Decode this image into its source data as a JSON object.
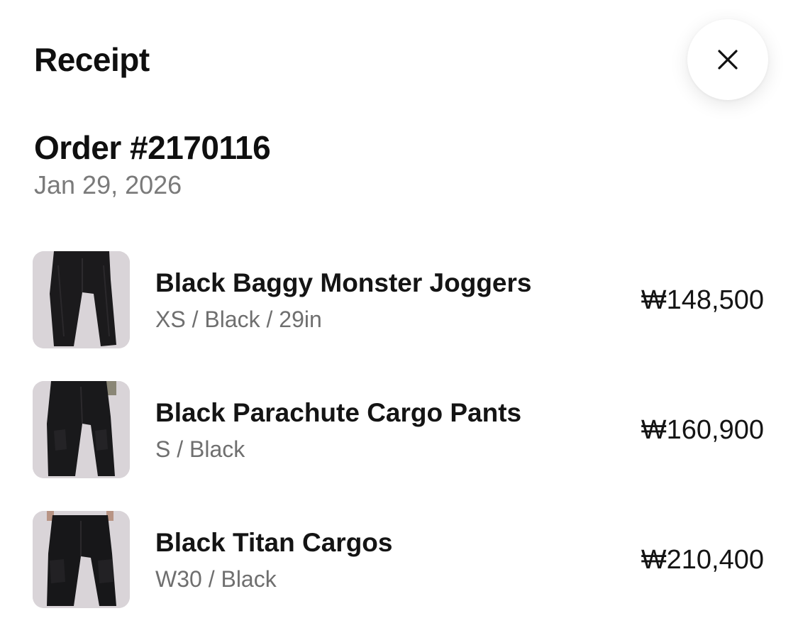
{
  "header": {
    "title": "Receipt",
    "close_icon": "close-icon"
  },
  "order": {
    "number": "Order #2170116",
    "date": "Jan 29, 2026"
  },
  "items": [
    {
      "name": "Black Baggy Monster Joggers",
      "variant": "XS / Black / 29in",
      "price": "₩148,500",
      "image": "product-image-joggers"
    },
    {
      "name": "Black Parachute Cargo Pants",
      "variant": "S / Black",
      "price": "₩160,900",
      "image": "product-image-parachute-cargo"
    },
    {
      "name": "Black Titan Cargos",
      "variant": "W30 / Black",
      "price": "₩210,400",
      "image": "product-image-titan-cargos"
    }
  ],
  "colors": {
    "text_primary": "#141414",
    "text_secondary": "#6f6f6f",
    "thumb_background": "#d9d4d8",
    "garment": "#1a1a1c"
  }
}
